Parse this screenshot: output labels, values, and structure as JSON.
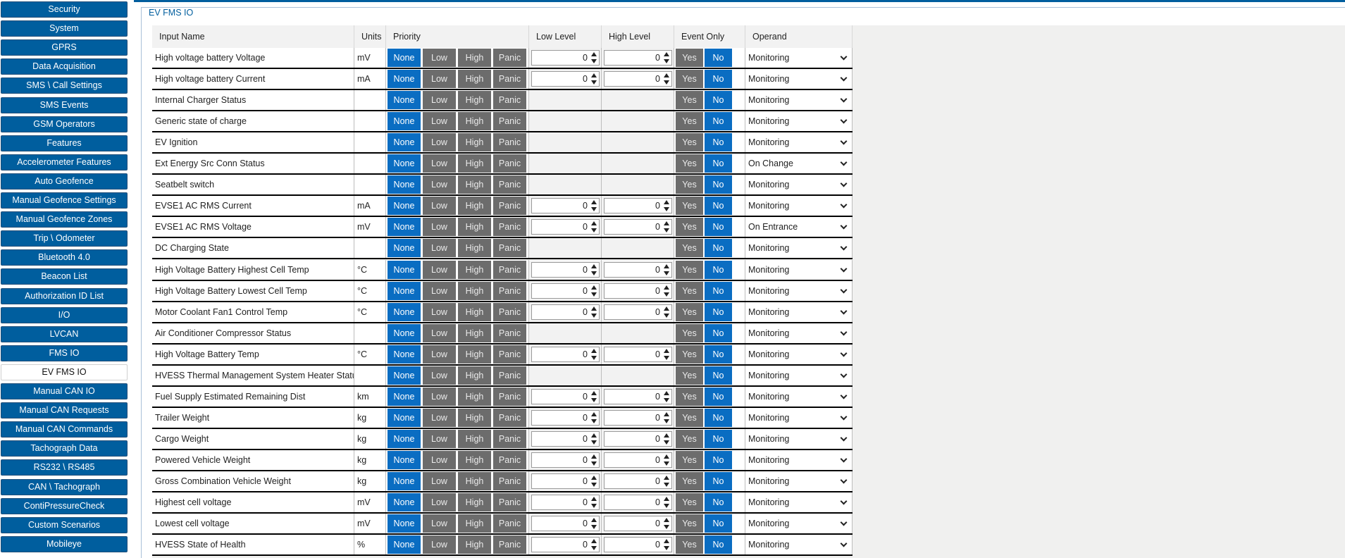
{
  "sidebar": {
    "items": [
      {
        "label": "Security",
        "active": false
      },
      {
        "label": "System",
        "active": false
      },
      {
        "label": "GPRS",
        "active": false
      },
      {
        "label": "Data Acquisition",
        "active": false
      },
      {
        "label": "SMS \\ Call Settings",
        "active": false
      },
      {
        "label": "SMS Events",
        "active": false
      },
      {
        "label": "GSM Operators",
        "active": false
      },
      {
        "label": "Features",
        "active": false
      },
      {
        "label": "Accelerometer Features",
        "active": false
      },
      {
        "label": "Auto Geofence",
        "active": false
      },
      {
        "label": "Manual Geofence Settings",
        "active": false
      },
      {
        "label": "Manual Geofence Zones",
        "active": false
      },
      {
        "label": "Trip \\ Odometer",
        "active": false
      },
      {
        "label": "Bluetooth 4.0",
        "active": false
      },
      {
        "label": "Beacon List",
        "active": false
      },
      {
        "label": "Authorization ID List",
        "active": false
      },
      {
        "label": "I/O",
        "active": false
      },
      {
        "label": "LVCAN",
        "active": false
      },
      {
        "label": "FMS IO",
        "active": false
      },
      {
        "label": "EV FMS IO",
        "active": true
      },
      {
        "label": "Manual CAN IO",
        "active": false
      },
      {
        "label": "Manual CAN Requests",
        "active": false
      },
      {
        "label": "Manual CAN Commands",
        "active": false
      },
      {
        "label": "Tachograph Data",
        "active": false
      },
      {
        "label": "RS232 \\ RS485",
        "active": false
      },
      {
        "label": "CAN \\ Tachograph",
        "active": false
      },
      {
        "label": "ContiPressureCheck",
        "active": false
      },
      {
        "label": "Custom Scenarios",
        "active": false
      },
      {
        "label": "Mobileye",
        "active": false
      }
    ]
  },
  "panel": {
    "title": "EV FMS IO"
  },
  "table": {
    "headers": {
      "name": "Input Name",
      "units": "Units",
      "priority": "Priority",
      "low": "Low Level",
      "high": "High Level",
      "event": "Event Only",
      "operand": "Operand"
    },
    "priority_options": [
      "None",
      "Low",
      "High",
      "Panic"
    ],
    "event_options": [
      "Yes",
      "No"
    ],
    "rows": [
      {
        "name": "High voltage battery Voltage",
        "unit": "mV",
        "low": "0",
        "high": "0",
        "operand": "Monitoring"
      },
      {
        "name": "High voltage battery Current",
        "unit": "mA",
        "low": "0",
        "high": "0",
        "operand": "Monitoring"
      },
      {
        "name": "Internal Charger Status",
        "unit": "",
        "low": null,
        "high": null,
        "operand": "Monitoring"
      },
      {
        "name": "Generic state of charge",
        "unit": "",
        "low": null,
        "high": null,
        "operand": "Monitoring"
      },
      {
        "name": "EV Ignition",
        "unit": "",
        "low": null,
        "high": null,
        "operand": "Monitoring"
      },
      {
        "name": "Ext Energy Src Conn Status",
        "unit": "",
        "low": null,
        "high": null,
        "operand": "On Change"
      },
      {
        "name": "Seatbelt switch",
        "unit": "",
        "low": null,
        "high": null,
        "operand": "Monitoring"
      },
      {
        "name": "EVSE1 AC RMS Current",
        "unit": "mA",
        "low": "0",
        "high": "0",
        "operand": "Monitoring"
      },
      {
        "name": "EVSE1 AC RMS Voltage",
        "unit": "mV",
        "low": "0",
        "high": "0",
        "operand": "On Entrance"
      },
      {
        "name": "DC Charging State",
        "unit": "",
        "low": null,
        "high": null,
        "operand": "Monitoring"
      },
      {
        "name": "High Voltage Battery Highest Cell Temp",
        "unit": "°C",
        "low": "0",
        "high": "0",
        "operand": "Monitoring"
      },
      {
        "name": "High Voltage Battery Lowest Cell Temp",
        "unit": "°C",
        "low": "0",
        "high": "0",
        "operand": "Monitoring"
      },
      {
        "name": "Motor Coolant Fan1 Control Temp",
        "unit": "°C",
        "low": "0",
        "high": "0",
        "operand": "Monitoring"
      },
      {
        "name": "Air Conditioner Compressor Status",
        "unit": "",
        "low": null,
        "high": null,
        "operand": "Monitoring"
      },
      {
        "name": "High Voltage Battery Temp",
        "unit": "°C",
        "low": "0",
        "high": "0",
        "operand": "Monitoring"
      },
      {
        "name": "HVESS Thermal Management System Heater Status",
        "unit": "",
        "low": null,
        "high": null,
        "operand": "Monitoring"
      },
      {
        "name": "Fuel Supply Estimated Remaining Dist",
        "unit": "km",
        "low": "0",
        "high": "0",
        "operand": "Monitoring"
      },
      {
        "name": "Trailer Weight",
        "unit": "kg",
        "low": "0",
        "high": "0",
        "operand": "Monitoring"
      },
      {
        "name": "Cargo Weight",
        "unit": "kg",
        "low": "0",
        "high": "0",
        "operand": "Monitoring"
      },
      {
        "name": "Powered Vehicle Weight",
        "unit": "kg",
        "low": "0",
        "high": "0",
        "operand": "Monitoring"
      },
      {
        "name": "Gross Combination Vehicle Weight",
        "unit": "kg",
        "low": "0",
        "high": "0",
        "operand": "Monitoring"
      },
      {
        "name": "Highest cell voltage",
        "unit": "mV",
        "low": "0",
        "high": "0",
        "operand": "Monitoring"
      },
      {
        "name": "Lowest cell voltage",
        "unit": "mV",
        "low": "0",
        "high": "0",
        "operand": "Monitoring"
      },
      {
        "name": "HVESS State of Health",
        "unit": "%",
        "low": "0",
        "high": "0",
        "operand": "Monitoring"
      }
    ]
  },
  "colors": {
    "accent": "#005e9e",
    "selected": "#0a6dc2",
    "unselected": "#6c6c6c"
  },
  "selected": {
    "priority": "None",
    "event": "No"
  }
}
